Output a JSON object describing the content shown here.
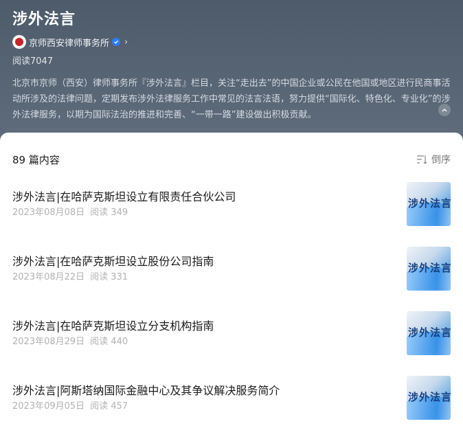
{
  "header": {
    "title": "涉外法言",
    "account_name": "京师西安律师事务所",
    "read_count": "阅读7047",
    "description": "北京市京师（西安）律师事务所『涉外法言』栏目，关注“走出去”的中国企业或公民在他国或地区进行民商事活动所涉及的法律问题，定期发布涉外法律服务工作中常见的法言法语，努力提供“国际化、特色化、专业化”的涉外法律服务，以期为国际法治的推进和完善、“一带一路”建设做出积极贡献。"
  },
  "list": {
    "count_label": "89 篇内容",
    "sort_label": "倒序",
    "articles": [
      {
        "title": "涉外法言|在哈萨克斯坦设立有限责任合伙公司",
        "date": "2023年08月08日",
        "reads": "阅读 349",
        "thumb_text": "涉外法言"
      },
      {
        "title": "涉外法言|在哈萨克斯坦设立股份公司指南",
        "date": "2023年08月22日",
        "reads": "阅读 331",
        "thumb_text": "涉外法言"
      },
      {
        "title": "涉外法言|在哈萨克斯坦设立分支机构指南",
        "date": "2023年08月29日",
        "reads": "阅读 440",
        "thumb_text": "涉外法言"
      },
      {
        "title": "涉外法言|阿斯塔纳国际金融中心及其争议解决服务简介",
        "date": "2023年09月05日",
        "reads": "阅读 457",
        "thumb_text": "涉外法言"
      }
    ]
  },
  "colors": {
    "header_bg": "#55626f",
    "verified": "#2b7cf6",
    "meta_text": "#b2b2b2"
  }
}
